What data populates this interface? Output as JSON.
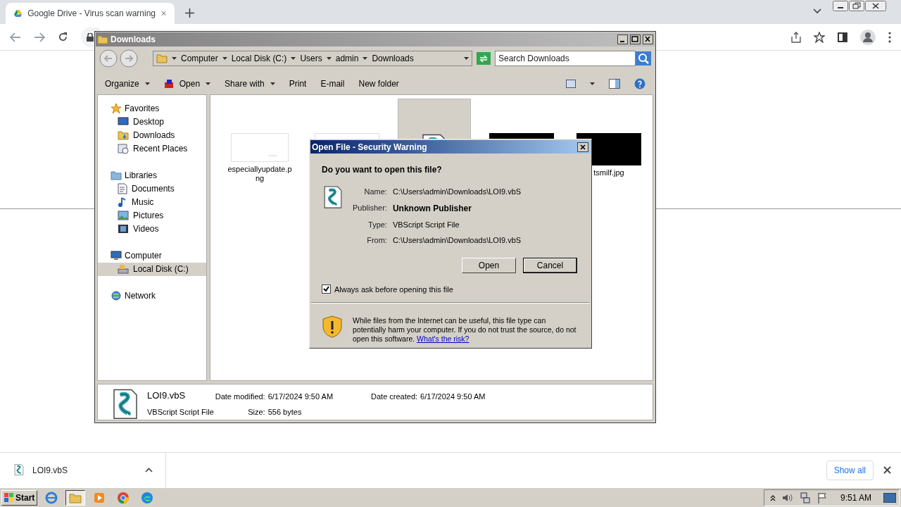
{
  "browser": {
    "tab": {
      "title": "Google Drive - Virus scan warning",
      "selected": true
    }
  },
  "explorer": {
    "title": "Downloads",
    "breadcrumb": [
      "Computer",
      "Local Disk (C:)",
      "Users",
      "admin",
      "Downloads"
    ],
    "search": {
      "placeholder": "Search Downloads"
    },
    "toolbar": [
      {
        "label": "Organize",
        "kind": "menu"
      },
      {
        "label": "Open",
        "kind": "menu"
      },
      {
        "label": "Share with",
        "kind": "menu"
      },
      {
        "label": "Print",
        "kind": "plain"
      },
      {
        "label": "E-mail",
        "kind": "plain"
      },
      {
        "label": "New folder",
        "kind": "plain"
      }
    ],
    "sidebar": [
      {
        "label": "Favorites",
        "selected": false,
        "children": [
          {
            "label": "Desktop",
            "selected": false
          },
          {
            "label": "Downloads",
            "selected": false
          },
          {
            "label": "Recent Places",
            "selected": false
          }
        ]
      },
      {
        "label": "Libraries",
        "selected": false,
        "children": [
          {
            "label": "Documents",
            "selected": false
          },
          {
            "label": "Music",
            "selected": false
          },
          {
            "label": "Pictures",
            "selected": false
          },
          {
            "label": "Videos",
            "selected": false
          }
        ]
      },
      {
        "label": "Computer",
        "selected": false,
        "children": [
          {
            "label": "Local Disk (C:)",
            "selected": true
          }
        ]
      },
      {
        "label": "Network",
        "selected": false
      }
    ],
    "files": [
      {
        "name": "especiallyupdate.png",
        "kind": "blank",
        "selected": false
      },
      {
        "kind": "blank",
        "selected": false
      },
      {
        "kind": "script",
        "selected": true
      },
      {
        "kind": "dark",
        "selected": false
      },
      {
        "name": "tsmilf.jpg",
        "kind": "dark",
        "selected": false
      }
    ],
    "details": {
      "name": "LOI9.vbS",
      "type": "VBScript Script File",
      "fields": [
        {
          "label": "Date modified:",
          "value": "6/17/2024 9:50 AM"
        },
        {
          "label": "Size:",
          "value": "556 bytes"
        },
        {
          "label": "Date created:",
          "value": "6/17/2024 9:50 AM"
        }
      ]
    }
  },
  "dialog": {
    "title": "Open File - Security Warning",
    "question": "Do you want to open this file?",
    "rows": [
      {
        "label": "Name:",
        "value": "C:\\Users\\admin\\Downloads\\LOI9.vbS",
        "emphasis": false
      },
      {
        "label": "Publisher:",
        "value": "Unknown Publisher",
        "emphasis": true
      },
      {
        "label": "Type:",
        "value": "VBScript Script File",
        "emphasis": false
      },
      {
        "label": "From:",
        "value": "C:\\Users\\admin\\Downloads\\LOI9.vbS",
        "emphasis": false
      }
    ],
    "buttons": [
      "Open",
      "Cancel"
    ],
    "checkbox": {
      "label": "Always ask before opening this file",
      "checked": true
    },
    "warning": "While files from the Internet can be useful, this file type can potentially harm your computer. If you do not trust the source, do not open this software.",
    "link": "What's the risk?"
  },
  "downloads_bar": {
    "item": "LOI9.vbS",
    "show_all": "Show all"
  },
  "taskbar": {
    "start": "Start",
    "apps": [
      {
        "kind": "ie",
        "selected": false
      },
      {
        "kind": "explorer",
        "selected": true
      },
      {
        "kind": "media",
        "selected": false
      },
      {
        "kind": "chrome",
        "selected": false
      },
      {
        "kind": "edge",
        "selected": false
      }
    ],
    "clock": "9:51 AM"
  }
}
